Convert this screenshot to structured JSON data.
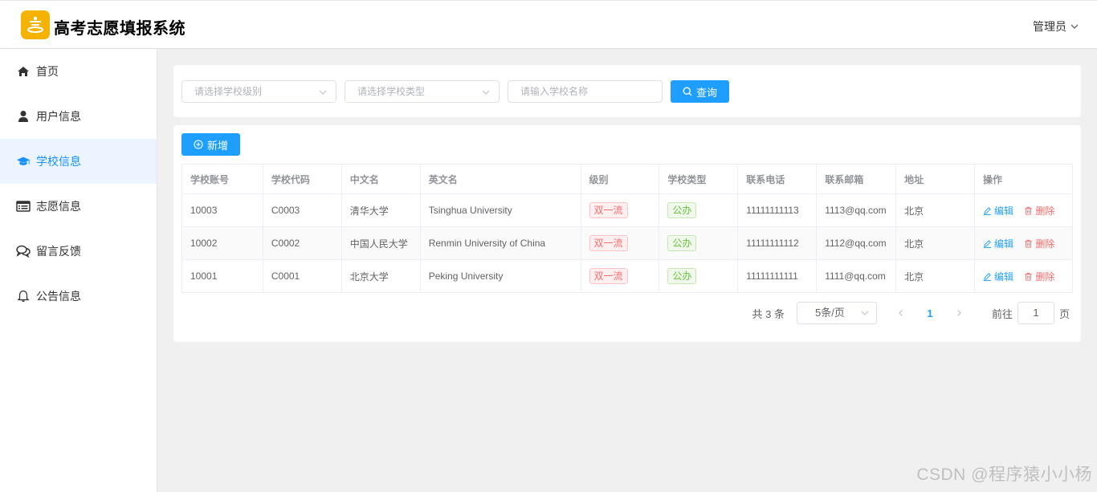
{
  "app": {
    "title": "高考志愿填报系统",
    "user": "管理员"
  },
  "sidebar": {
    "items": [
      {
        "label": "首页",
        "icon": "home-icon"
      },
      {
        "label": "用户信息",
        "icon": "user-icon"
      },
      {
        "label": "学校信息",
        "icon": "graduation-cap-icon",
        "active": true
      },
      {
        "label": "志愿信息",
        "icon": "list-card-icon"
      },
      {
        "label": "留言反馈",
        "icon": "chat-icon"
      },
      {
        "label": "公告信息",
        "icon": "bell-icon"
      }
    ]
  },
  "search": {
    "level_placeholder": "请选择学校级别",
    "type_placeholder": "请选择学校类型",
    "name_placeholder": "请输入学校名称",
    "button_label": "查询"
  },
  "toolbar": {
    "add_label": "新增"
  },
  "table": {
    "columns": [
      "学校账号",
      "学校代码",
      "中文名",
      "英文名",
      "级别",
      "学校类型",
      "联系电话",
      "联系邮箱",
      "地址",
      "操作"
    ],
    "rows": [
      {
        "account": "10003",
        "code": "C0003",
        "cn_name": "清华大学",
        "en_name": "Tsinghua University",
        "level": "双一流",
        "type": "公办",
        "phone": "11111111113",
        "email": "1113@qq.com",
        "address": "北京"
      },
      {
        "account": "10002",
        "code": "C0002",
        "cn_name": "中国人民大学",
        "en_name": "Renmin University of China",
        "level": "双一流",
        "type": "公办",
        "phone": "11111111112",
        "email": "1112@qq.com",
        "address": "北京"
      },
      {
        "account": "10001",
        "code": "C0001",
        "cn_name": "北京大学",
        "en_name": "Peking University",
        "level": "双一流",
        "type": "公办",
        "phone": "11111111111",
        "email": "1111@qq.com",
        "address": "北京"
      }
    ],
    "actions": {
      "edit": "编辑",
      "delete": "删除"
    }
  },
  "pagination": {
    "total": "共 3 条",
    "page_size": "5条/页",
    "current_page": "1",
    "goto_prefix": "前往",
    "goto_value": "1",
    "goto_suffix": "页"
  },
  "watermark": "CSDN @程序猿小小杨",
  "colors": {
    "primary": "#1e9fff",
    "danger": "#f56c6c",
    "success": "#67c23a",
    "logo": "#f5b300"
  }
}
